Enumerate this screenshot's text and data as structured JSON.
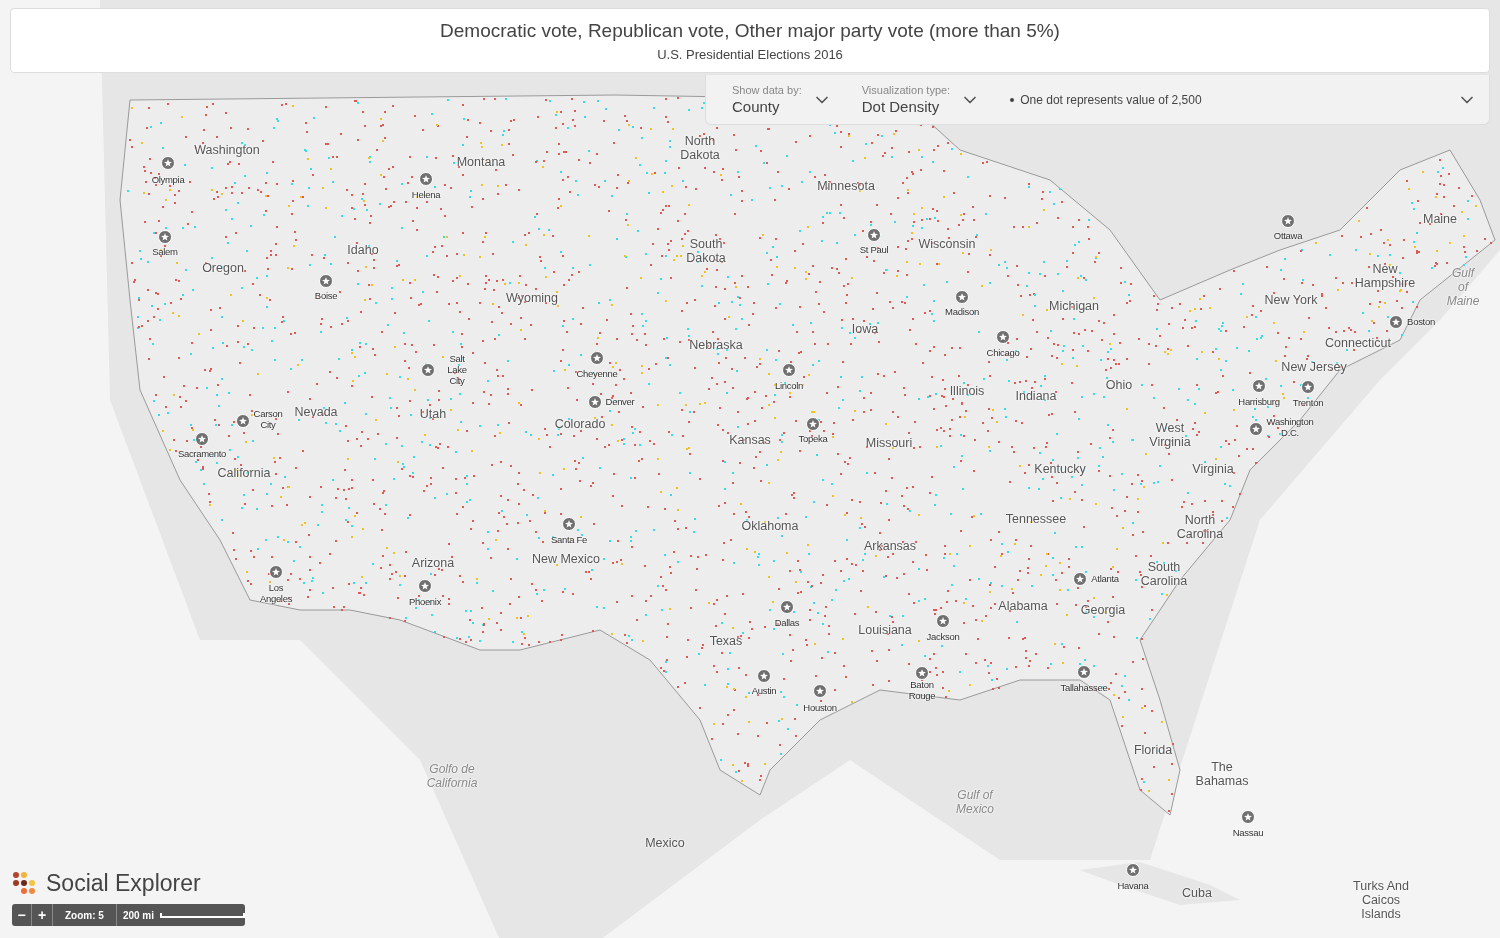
{
  "header": {
    "title": "Democratic vote, Republican vote, Other major party vote (more than 5%)",
    "subtitle": "U.S. Presidential Elections 2016"
  },
  "controls": {
    "show_data_by": {
      "label": "Show data by:",
      "value": "County"
    },
    "visualization_type": {
      "label": "Visualization type:",
      "value": "Dot Density"
    },
    "legend": "One dot represents value of 2,500"
  },
  "map": {
    "states": [
      "Washington",
      "Montana",
      "North Dakota",
      "Minnesota",
      "Idaho",
      "Oregon",
      "South Dakota",
      "Wisconsin",
      "Maine",
      "New Hampshire",
      "Wyoming",
      "Michigan",
      "New York",
      "Iowa",
      "Nebraska",
      "Connecticut",
      "New Jersey",
      "Illinois",
      "Indiana",
      "Ohio",
      "Nevada",
      "Utah",
      "Colorado",
      "Kansas",
      "Missouri",
      "West Virginia",
      "California",
      "Kentucky",
      "Virginia",
      "Tennessee",
      "Oklahoma",
      "North Carolina",
      "Arkansas",
      "New Mexico",
      "Arizona",
      "South Carolina",
      "Alabama",
      "Georgia",
      "Louisiana",
      "Texas",
      "Florida",
      "The Bahamas",
      "Mexico",
      "Cuba",
      "Turks And Caicos Islands"
    ],
    "water": [
      "Gulf of Maine",
      "Gulf of Mexico",
      "Golfo de California"
    ],
    "cities": [
      "Olympia",
      "Helena",
      "Salem",
      "Boise",
      "Salt Lake City",
      "Cheyenne",
      "Denver",
      "Carson City",
      "Sacramento",
      "Los Angeles",
      "Phoenix",
      "Santa Fe",
      "Lincoln",
      "Topeka",
      "Dallas",
      "Austin",
      "Houston",
      "Baton Rouge",
      "Jackson",
      "St Paul",
      "Madison",
      "Chicago",
      "Atlanta",
      "Tallahassee",
      "Ottawa",
      "Boston",
      "Harrisburg",
      "Trenton",
      "Washington D.C.",
      "Nassau",
      "Havana"
    ]
  },
  "brand": "Social Explorer",
  "zoom_controls": {
    "minus": "−",
    "plus": "+",
    "zoom": "Zoom: 5",
    "scale": "200 mi"
  }
}
